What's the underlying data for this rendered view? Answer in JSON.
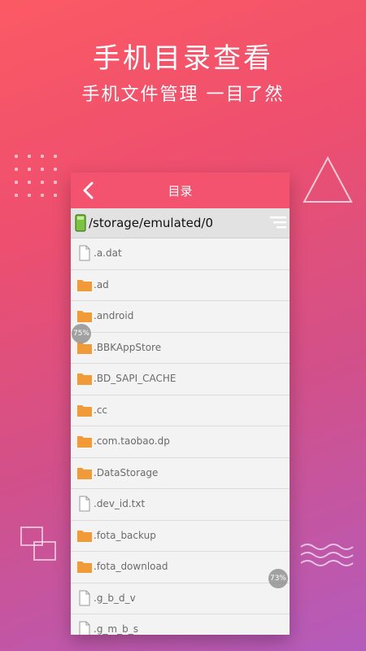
{
  "header": {
    "title": "手机目录查看",
    "subtitle": "手机文件管理  一目了然"
  },
  "app": {
    "screen_title": "目录",
    "current_path": "/storage/emulated/0"
  },
  "files": [
    {
      "name": ".a.dat",
      "type": "file"
    },
    {
      "name": ".ad",
      "type": "folder"
    },
    {
      "name": ".android",
      "type": "folder"
    },
    {
      "name": ".BBKAppStore",
      "type": "folder"
    },
    {
      "name": ".BD_SAPI_CACHE",
      "type": "folder"
    },
    {
      "name": ".cc",
      "type": "folder"
    },
    {
      "name": ".com.taobao.dp",
      "type": "folder"
    },
    {
      "name": ".DataStorage",
      "type": "folder"
    },
    {
      "name": ".dev_id.txt",
      "type": "file"
    },
    {
      "name": ".fota_backup",
      "type": "folder"
    },
    {
      "name": ".fota_download",
      "type": "folder"
    },
    {
      "name": ".g_b_d_v",
      "type": "file"
    },
    {
      "name": ".g_m_b_s",
      "type": "file"
    }
  ],
  "overlays": {
    "badge_left": "75%",
    "badge_right": "73%"
  },
  "colors": {
    "titlebar": "#f4536f",
    "folder": "#f19a38",
    "background_top": "#fb5a64",
    "background_bottom": "#b45cbc"
  }
}
